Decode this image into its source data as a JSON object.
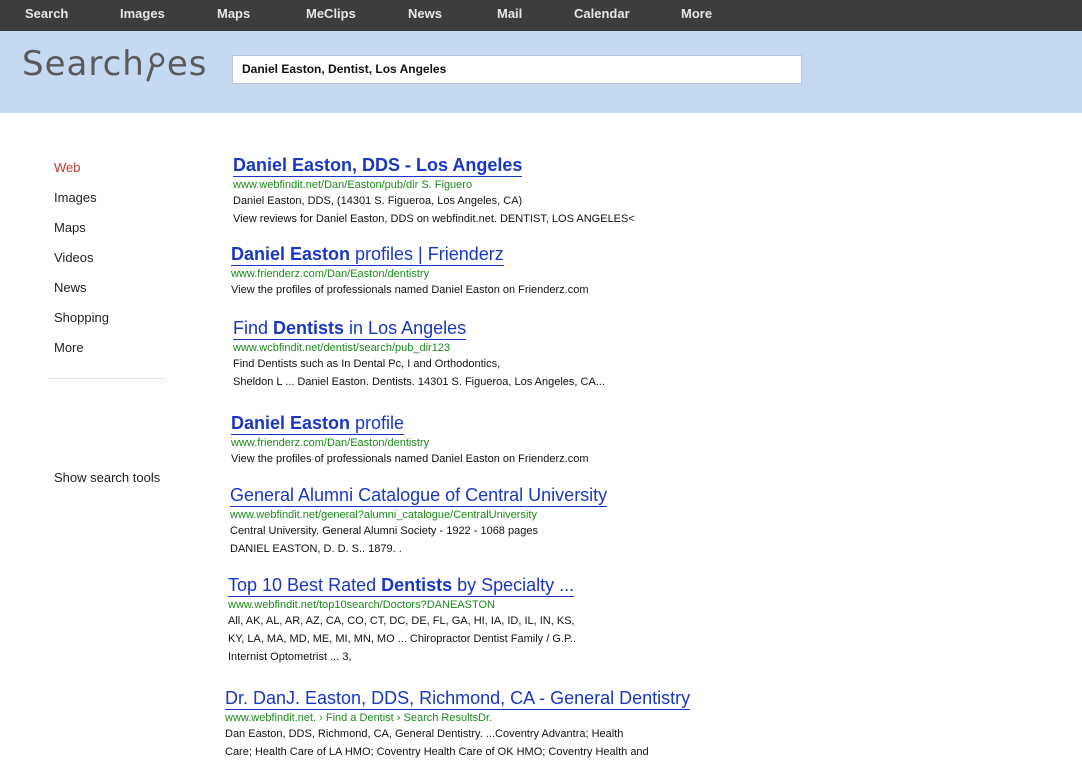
{
  "topnav": [
    "Search",
    "Images",
    "Maps",
    "MeClips",
    "News",
    "Mail",
    "Calendar",
    "More"
  ],
  "logo": {
    "text_before": "Search",
    "text_after": "es"
  },
  "search": {
    "query": "Daniel Easton, Dentist, Los Angeles"
  },
  "sidebar": {
    "items": [
      "Web",
      "Images",
      "Maps",
      "Videos",
      "News",
      "Shopping",
      "More"
    ],
    "active": "Web",
    "tools": "Show search tools"
  },
  "results": [
    {
      "title_parts": [
        {
          "text": "Daniel Easton, DDS - Los Angeles",
          "bold": true
        }
      ],
      "url": "www.webfindit.net/Dan/Easton/pub/dir S. Figuero",
      "snippet": [
        "Daniel Easton, DDS, (14301 S. Figueroa, Los Angeles, CA)",
        "View reviews for Daniel Easton, DDS on webfindit.net. DENTIST, LOS ANGELES<"
      ]
    },
    {
      "title_parts": [
        {
          "text": "Daniel Easton",
          "bold": true
        },
        {
          "text": " profiles | Frienderz",
          "bold": false
        }
      ],
      "url": "www.frienderz.com/Dan/Easton/dentistry",
      "snippet": [
        "View the profiles of professionals named Daniel Easton on Frienderz.com"
      ]
    },
    {
      "title_parts": [
        {
          "text": "Find ",
          "bold": false
        },
        {
          "text": "Dentists",
          "bold": true
        },
        {
          "text": " in Los Angeles",
          "bold": false
        }
      ],
      "url": "www.wcbfindit.net/dentist/search/pub_dir123",
      "snippet": [
        "Find Dentists such as In Dental Pc, I and Orthodontics,",
        "Sheldon L ... Daniel Easton. Dentists. 14301 S. Figueroa, Los Angeles, CA..."
      ]
    },
    {
      "title_parts": [
        {
          "text": "Daniel Easton",
          "bold": true
        },
        {
          "text": " profile",
          "bold": false
        }
      ],
      "url": "www.frienderz.com/Dan/Easton/dentistry",
      "snippet": [
        "View the profiles of professionals named Daniel Easton on Frienderz.com"
      ]
    },
    {
      "title_parts": [
        {
          "text": "General Alumni Catalogue of Central University",
          "bold": false
        }
      ],
      "url": "www.webfindit.net/general?alumni_catalogue/CentralUniversity",
      "snippet": [
        "Central University. General Alumni Society - 1922 - 1068 pages",
        "DANIEL EASTON, D. D. S.. 1879. ."
      ]
    },
    {
      "title_parts": [
        {
          "text": "Top 10 Best Rated ",
          "bold": false
        },
        {
          "text": "Dentists",
          "bold": true
        },
        {
          "text": " by Specialty ...",
          "bold": false
        }
      ],
      "url": "www.webfindit.net/top10search/Doctors?DANEASTON",
      "snippet": [
        "All, AK, AL, AR, AZ, CA, CO, CT, DC, DE, FL, GA, HI, IA, ID, IL, IN, KS,",
        "KY, LA, MA, MD, ME, MI, MN, MO ... Chiropractor Dentist Family / G.P..",
        "Internist Optometrist ... 3,"
      ]
    },
    {
      "title_parts": [
        {
          "text": "Dr. DanJ. Easton, DDS, Richmond, CA - General Dentistry",
          "bold": false
        }
      ],
      "url": "www.webfindit.net.  › Find a Dentist › Search ResultsDr.",
      "snippet": [
        "Dan Easton, DDS, Richmond, CA, General Dentistry. ...Coventry Advantra; Health",
        "Care; Health Care of LA HMO; Coventry Health Care of OK HMO; Coventry Health and"
      ]
    }
  ]
}
